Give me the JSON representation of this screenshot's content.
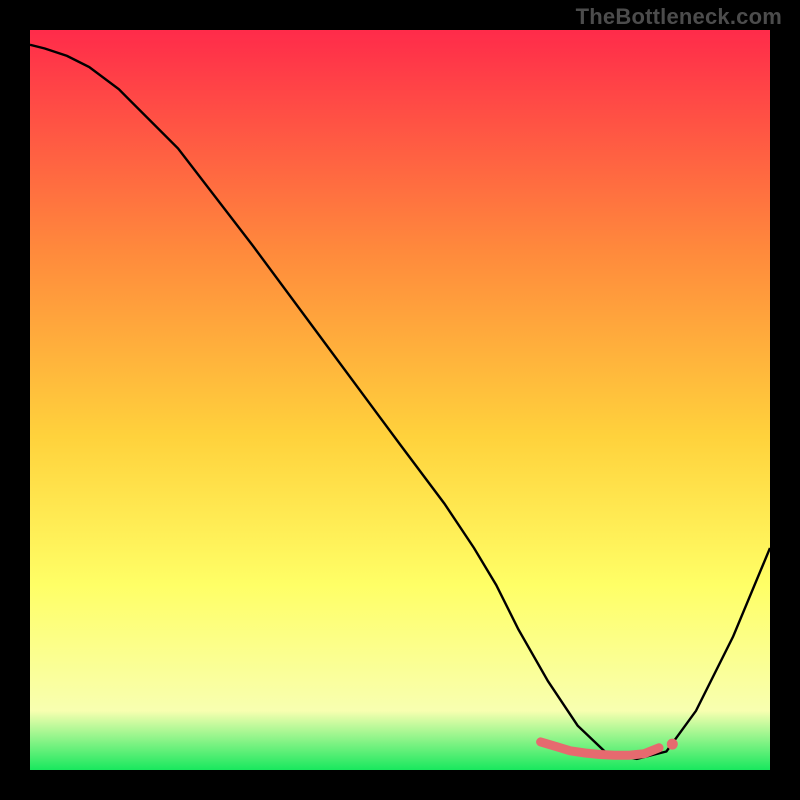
{
  "watermark": "TheBottleneck.com",
  "colors": {
    "frame": "#000000",
    "watermark": "#4c4c4c",
    "gradient_top": "#ff2b4a",
    "gradient_mid1": "#ff8a3c",
    "gradient_mid2": "#ffd23c",
    "gradient_mid3": "#ffff66",
    "gradient_mid4": "#f8ffb0",
    "gradient_bottom": "#18e85e",
    "curve": "#000000",
    "markers": "#e66a6f"
  },
  "chart_data": {
    "type": "line",
    "title": "",
    "xlabel": "",
    "ylabel": "",
    "xlim": [
      0,
      100
    ],
    "ylim": [
      0,
      100
    ],
    "series": [
      {
        "name": "bottleneck-curve",
        "x": [
          0,
          2,
          5,
          8,
          12,
          20,
          30,
          40,
          50,
          56,
          60,
          63,
          66,
          70,
          74,
          78,
          82,
          86,
          90,
          95,
          100
        ],
        "y": [
          98,
          97.5,
          96.5,
          95,
          92,
          84,
          71,
          57.5,
          44,
          36,
          30,
          25,
          19,
          12,
          6,
          2.2,
          1.5,
          2.5,
          8,
          18,
          30
        ]
      }
    ],
    "markers": {
      "name": "optimal-range",
      "x": [
        69,
        71,
        73,
        75,
        77,
        79,
        81,
        83,
        85
      ],
      "y": [
        3.8,
        3.2,
        2.6,
        2.3,
        2.1,
        2.0,
        2.0,
        2.2,
        3.0
      ]
    }
  }
}
